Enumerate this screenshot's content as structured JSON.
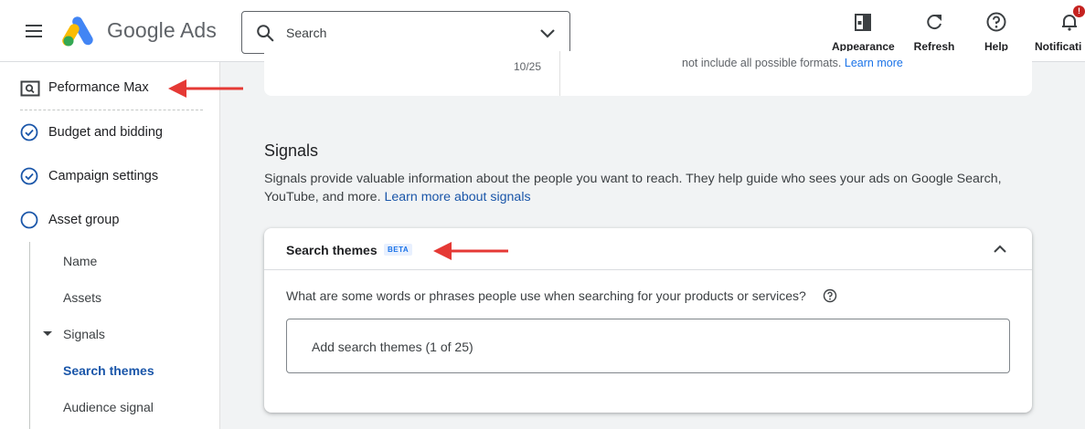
{
  "header": {
    "brand": "Google Ads",
    "search_placeholder": "Search",
    "tools": [
      {
        "label": "Appearance",
        "icon": "appearance-icon"
      },
      {
        "label": "Refresh",
        "icon": "refresh-icon"
      },
      {
        "label": "Help",
        "icon": "help-icon"
      },
      {
        "label": "Notificati",
        "icon": "bell-icon"
      }
    ],
    "notification_badge": "!"
  },
  "sidebar": {
    "campaign_type": "Peformance Max",
    "steps": [
      {
        "label": "Budget and bidding",
        "state": "done"
      },
      {
        "label": "Campaign settings",
        "state": "done"
      },
      {
        "label": "Asset group",
        "state": "current"
      }
    ],
    "sub_items": [
      {
        "label": "Name"
      },
      {
        "label": "Assets"
      },
      {
        "label": "Signals",
        "expanded": true
      },
      {
        "label": "Search themes",
        "active": true
      },
      {
        "label": "Audience signal"
      }
    ]
  },
  "main": {
    "top_card": {
      "counter": "10/25",
      "fragment_text": "not include all possible formats.",
      "fragment_link": "Learn more"
    },
    "signals": {
      "title": "Signals",
      "description": "Signals provide valuable information about the people you want to reach. They help guide who sees your ads on Google Search, YouTube, and more.",
      "link": "Learn more about signals"
    },
    "search_themes": {
      "title": "Search themes",
      "badge": "BETA",
      "question": "What are some words or phrases people use when searching for your products or services?",
      "input_placeholder": "Add search themes (1 of 25)"
    }
  },
  "colors": {
    "accent_blue": "#1a73e8",
    "link_blue": "#1a56a9",
    "annotation_red": "#e53935",
    "background": "#f1f3f4"
  }
}
